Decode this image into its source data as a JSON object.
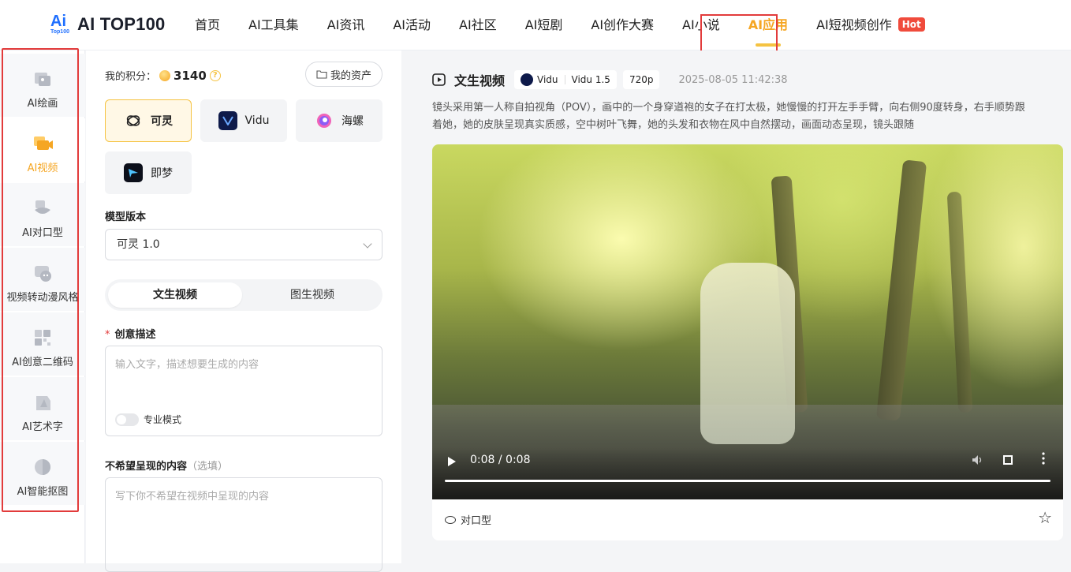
{
  "logo": {
    "mark": "Ai",
    "mark_sub": "Top100",
    "text": "AI TOP100"
  },
  "nav": {
    "items": [
      {
        "label": "首页"
      },
      {
        "label": "AI工具集"
      },
      {
        "label": "AI资讯"
      },
      {
        "label": "AI活动"
      },
      {
        "label": "AI社区"
      },
      {
        "label": "AI短剧"
      },
      {
        "label": "AI创作大赛"
      },
      {
        "label": "AI小说"
      },
      {
        "label": "AI应用",
        "active": true
      },
      {
        "label": "AI短视频创作"
      }
    ],
    "hot_badge": "Hot"
  },
  "sidebar": {
    "items": [
      {
        "label": "AI绘画",
        "icon": "image-icon"
      },
      {
        "label": "AI视频",
        "icon": "video-icon",
        "active": true
      },
      {
        "label": "AI对口型",
        "icon": "lips-icon"
      },
      {
        "label": "视频转动漫风格",
        "icon": "anime-icon"
      },
      {
        "label": "AI创意二维码",
        "icon": "qrcode-icon"
      },
      {
        "label": "AI艺术字",
        "icon": "art-text-icon"
      },
      {
        "label": "AI智能抠图",
        "icon": "cutout-icon"
      }
    ]
  },
  "panel": {
    "points_label": "我的积分：",
    "points_value": "3140",
    "help_glyph": "?",
    "assets_button": "我的资产",
    "models": [
      {
        "label": "可灵",
        "selected": true
      },
      {
        "label": "Vidu"
      },
      {
        "label": "海螺"
      },
      {
        "label": "即梦"
      }
    ],
    "model_version_label": "模型版本",
    "model_version_value": "可灵 1.0",
    "tabs": [
      "文生视频",
      "图生视频"
    ],
    "prompt_label": "创意描述",
    "required_mark": "*",
    "prompt_placeholder": "输入文字，描述想要生成的内容",
    "pro_mode_label": "专业模式",
    "negative_label": "不希望呈现的内容",
    "negative_optional": "（选填）",
    "negative_placeholder": "写下你不希望在视频中呈现的内容"
  },
  "result": {
    "title": "文生视频",
    "model_chip": "Vidu",
    "version_chip": "Vidu 1.5",
    "resolution_chip": "720p",
    "timestamp": "2025-08-05 11:42:38",
    "description_line1": "镜头采用第一人称自拍视角（POV），画中的一个身穿道袍的女子在打太极，她慢慢的打开左手手臂，向右侧90度转身，右手顺势跟",
    "description_line2": "着她，她的皮肤呈现真实质感，空中树叶飞舞，她的头发和衣物在风中自然摆动，画面动态呈现，镜头跟随",
    "video_time": "0:08 / 0:08",
    "video_progress": 1.0,
    "lipsync_label": "对口型",
    "star_glyph": "☆"
  },
  "colors": {
    "accent": "#f5a623",
    "highlight_box": "#e23b3b",
    "hot": "#f04b3c",
    "brand_blue": "#1f6fff"
  }
}
